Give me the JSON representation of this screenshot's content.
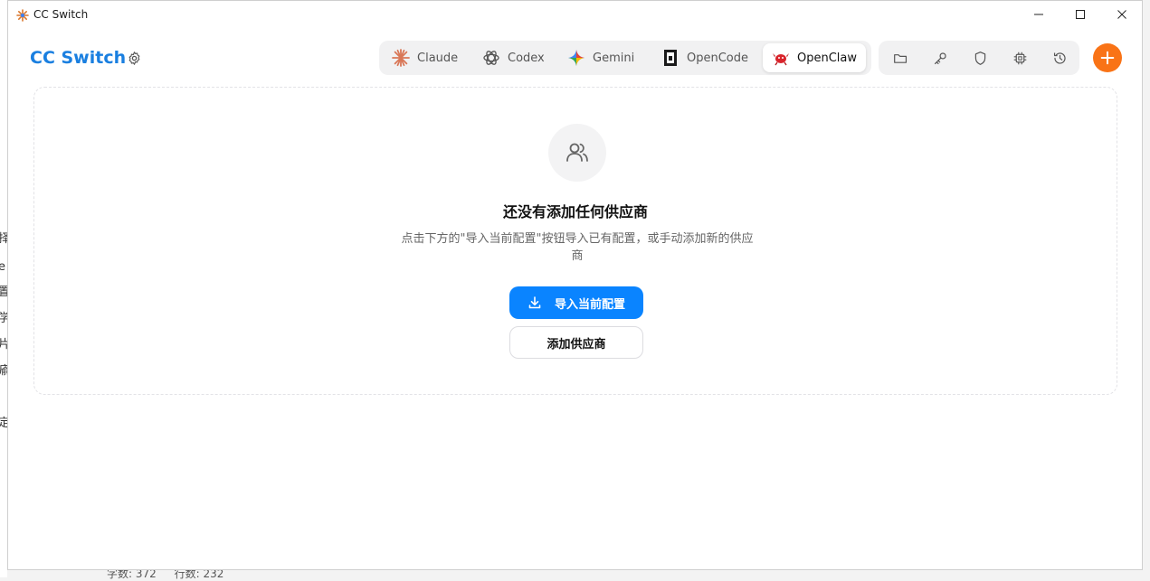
{
  "window": {
    "title": "CC Switch"
  },
  "app": {
    "brand": "CC Switch"
  },
  "tabs": [
    {
      "label": "Claude",
      "icon": "claude-icon"
    },
    {
      "label": "Codex",
      "icon": "codex-icon"
    },
    {
      "label": "Gemini",
      "icon": "gemini-icon"
    },
    {
      "label": "OpenCode",
      "icon": "opencode-icon"
    },
    {
      "label": "OpenClaw",
      "icon": "openclaw-icon",
      "active": true
    }
  ],
  "tools": [
    "folder-icon",
    "key-icon",
    "shield-icon",
    "chip-icon",
    "history-icon"
  ],
  "empty": {
    "title": "还没有添加任何供应商",
    "desc": "点击下方的\"导入当前配置\"按钮导入已有配置，或手动添加新的供应商",
    "import_label": "导入当前配置",
    "add_label": "添加供应商"
  },
  "background": {
    "glyphs": [
      "择",
      "e",
      "置",
      "学",
      "片",
      "瘉",
      "定"
    ],
    "status_left": "字数: 372",
    "status_right": "行数: 232"
  },
  "colors": {
    "brand": "#1a7fe0",
    "primary": "#0a84ff",
    "fab": "#f97316"
  }
}
